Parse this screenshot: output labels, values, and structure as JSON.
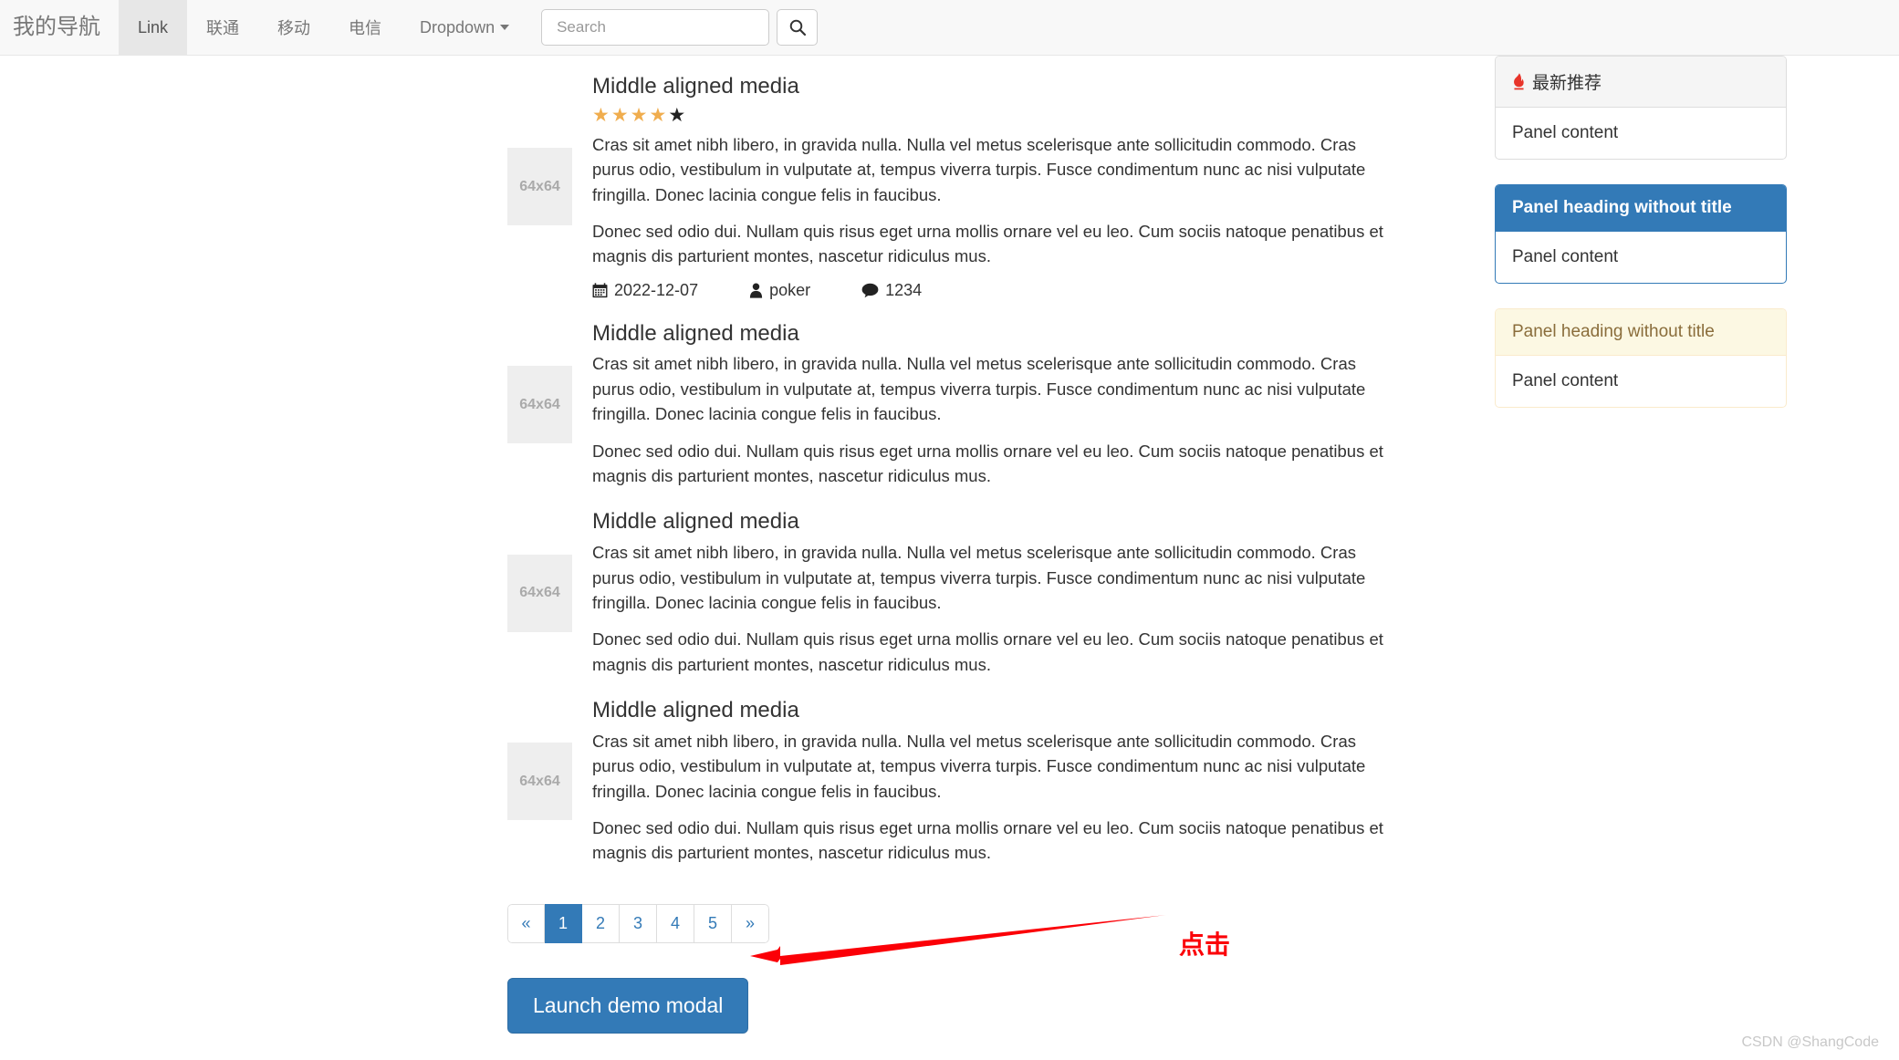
{
  "navbar": {
    "brand": "我的导航",
    "items": [
      {
        "label": "Link",
        "active": true,
        "dropdown": false
      },
      {
        "label": "联通",
        "active": false,
        "dropdown": false
      },
      {
        "label": "移动",
        "active": false,
        "dropdown": false
      },
      {
        "label": "电信",
        "active": false,
        "dropdown": false
      },
      {
        "label": "Dropdown",
        "active": false,
        "dropdown": true
      }
    ],
    "search": {
      "placeholder": "Search",
      "value": "",
      "button_icon": "search-icon"
    }
  },
  "media_items": [
    {
      "heading": "Middle aligned media",
      "thumb_label": "64x64",
      "rating": {
        "filled": 4,
        "total": 5,
        "filled_color": "#f0ad4e",
        "empty_color": "#222222"
      },
      "paragraphs": [
        "Cras sit amet nibh libero, in gravida nulla. Nulla vel metus scelerisque ante sollicitudin commodo. Cras purus odio, vestibulum in vulputate at, tempus viverra turpis. Fusce condimentum nunc ac nisi vulputate fringilla. Donec lacinia congue felis in faucibus.",
        "Donec sed odio dui. Nullam quis risus eget urna mollis ornare vel eu leo. Cum sociis natoque penatibus et magnis dis parturient montes, nascetur ridiculus mus."
      ],
      "meta": {
        "date_icon": "calendar-icon",
        "date": "2022-12-07",
        "author_icon": "user-icon",
        "author": "poker",
        "comments_icon": "comment-icon",
        "comments": "1234"
      }
    },
    {
      "heading": "Middle aligned media",
      "thumb_label": "64x64",
      "paragraphs": [
        "Cras sit amet nibh libero, in gravida nulla. Nulla vel metus scelerisque ante sollicitudin commodo. Cras purus odio, vestibulum in vulputate at, tempus viverra turpis. Fusce condimentum nunc ac nisi vulputate fringilla. Donec lacinia congue felis in faucibus.",
        "Donec sed odio dui. Nullam quis risus eget urna mollis ornare vel eu leo. Cum sociis natoque penatibus et magnis dis parturient montes, nascetur ridiculus mus."
      ]
    },
    {
      "heading": "Middle aligned media",
      "thumb_label": "64x64",
      "paragraphs": [
        "Cras sit amet nibh libero, in gravida nulla. Nulla vel metus scelerisque ante sollicitudin commodo. Cras purus odio, vestibulum in vulputate at, tempus viverra turpis. Fusce condimentum nunc ac nisi vulputate fringilla. Donec lacinia congue felis in faucibus.",
        "Donec sed odio dui. Nullam quis risus eget urna mollis ornare vel eu leo. Cum sociis natoque penatibus et magnis dis parturient montes, nascetur ridiculus mus."
      ]
    },
    {
      "heading": "Middle aligned media",
      "thumb_label": "64x64",
      "paragraphs": [
        "Cras sit amet nibh libero, in gravida nulla. Nulla vel metus scelerisque ante sollicitudin commodo. Cras purus odio, vestibulum in vulputate at, tempus viverra turpis. Fusce condimentum nunc ac nisi vulputate fringilla. Donec lacinia congue felis in faucibus.",
        "Donec sed odio dui. Nullam quis risus eget urna mollis ornare vel eu leo. Cum sociis natoque penatibus et magnis dis parturient montes, nascetur ridiculus mus."
      ]
    }
  ],
  "pagination": {
    "prev": "«",
    "next": "»",
    "pages": [
      "1",
      "2",
      "3",
      "4",
      "5"
    ],
    "active_page": "1",
    "active_color": "#337ab7",
    "link_color": "#337ab7"
  },
  "modal_button": {
    "label": "Launch demo modal",
    "background": "#337ab7"
  },
  "panels": [
    {
      "style": "default",
      "icon": "flame-icon",
      "heading": "最新推荐",
      "body": "Panel content",
      "heading_bg": "#f5f5f5"
    },
    {
      "style": "primary",
      "icon": null,
      "heading": "Panel heading without title",
      "body": "Panel content",
      "heading_bg": "#337ab7"
    },
    {
      "style": "warning",
      "icon": null,
      "heading": "Panel heading without title",
      "body": "Panel content",
      "heading_bg": "#fcf8e3"
    }
  ],
  "annotation": {
    "text": "点击",
    "color": "#fb0007",
    "arrow": "left-pointing-arrow"
  },
  "watermark": "CSDN @ShangCode"
}
